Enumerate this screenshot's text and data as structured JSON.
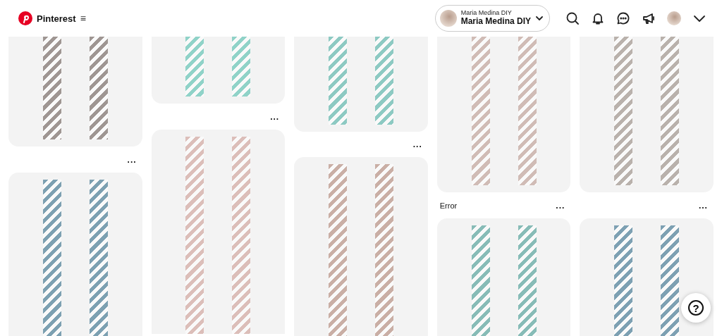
{
  "header": {
    "brand": "Pinterest",
    "menu_glyph": "≡",
    "account": {
      "caption": "Maria Medina DIY",
      "name": "Maria Medina DIY"
    }
  },
  "columns": [
    {
      "pins": [
        {
          "kind": "cut_top",
          "more": "..."
        },
        {
          "kind": "cut_bottom"
        }
      ]
    },
    {
      "pins": [
        {
          "kind": "cut_top",
          "more": "..."
        },
        {
          "kind": "cut_bottom"
        }
      ]
    },
    {
      "pins": [
        {
          "kind": "cut_top",
          "more": "..."
        },
        {
          "kind": "cut_bottom"
        }
      ]
    },
    {
      "pins": [
        {
          "kind": "cut_top",
          "title": "Error",
          "more": "..."
        },
        {
          "kind": "cut_bottom"
        }
      ]
    },
    {
      "pins": [
        {
          "kind": "cut_top",
          "more": "..."
        },
        {
          "kind": "cut_bottom"
        }
      ]
    }
  ],
  "help_button": "?"
}
